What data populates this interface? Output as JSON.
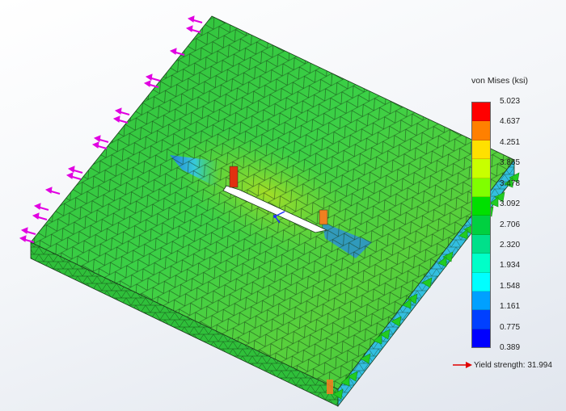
{
  "legend": {
    "title": "von Mises (ksi)",
    "labels": [
      "5.023",
      "4.637",
      "4.251",
      "3.865",
      "3.478",
      "3.092",
      "2.706",
      "2.320",
      "1.934",
      "1.548",
      "1.161",
      "0.775",
      "0.389"
    ],
    "colors": [
      "#ff0000",
      "#ff8000",
      "#ffe000",
      "#c8ff00",
      "#80ff00",
      "#00e000",
      "#00d040",
      "#00e08a",
      "#00ffc8",
      "#00ffff",
      "#00a0ff",
      "#0040ff",
      "#0000ff"
    ]
  },
  "yield": {
    "label": "Yield strength: 31.994",
    "arrow_color": "#e00000"
  },
  "model": {
    "surface_color": "#33c83a",
    "edge_color": "#1a3a1a",
    "load_arrow_color": "#e100e1",
    "fixture_arrow_color": "#22cc22"
  }
}
